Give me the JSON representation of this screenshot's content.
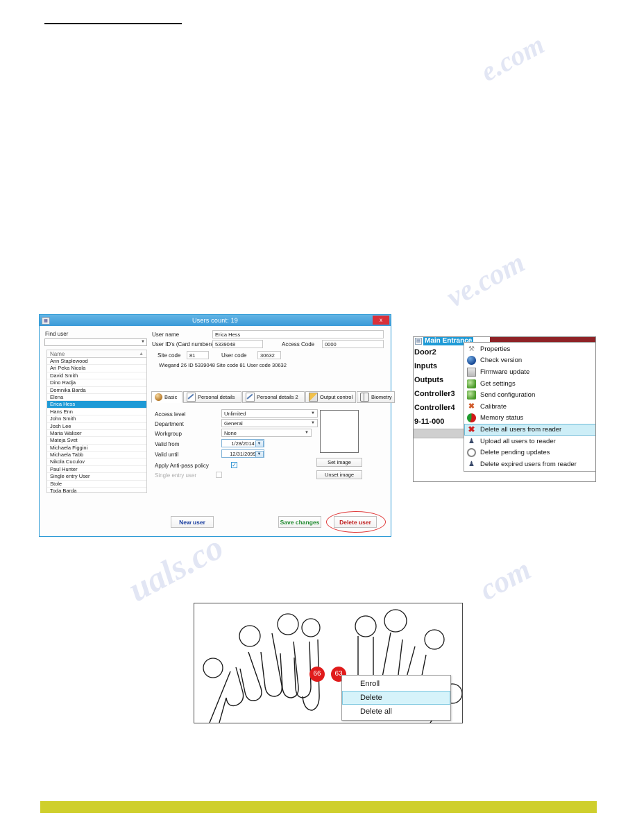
{
  "page": {
    "rule": "",
    "bottom_bar_color": "#cfcf2c",
    "watermarks": [
      "manualshive.com",
      "manualshive.com",
      "manualshive.com",
      "manualshive"
    ]
  },
  "users_dialog": {
    "title": "Users count: 19",
    "close_label": "x",
    "window_icon": "users-icon",
    "find_user_label": "Find user",
    "find_user_value": "",
    "list_header": "Name",
    "users": [
      "Ann Staplewood",
      "Ari Peka Nicola",
      "David Smith",
      "Dino Radja",
      "Domnika Barda",
      "Elena",
      "Erica Hess",
      "Hans Enn",
      "John Smith",
      "Josh Lee",
      "Maria Waliser",
      "Mateja Svet",
      "Michaela Figgini",
      "Michaela Tabb",
      "Nikola Cuculov",
      "Paul Hunter",
      "Single entry User",
      "Stole",
      "Toda Barda"
    ],
    "selected_user": "Erica Hess",
    "fields": {
      "user_name_label": "User name",
      "user_name_value": "Erica Hess",
      "user_ids_label": "User ID's (Card numbers)",
      "user_ids_value": "5339048",
      "access_code_label": "Access Code",
      "access_code_value": "0000",
      "site_code_label": "Site code",
      "site_code_value": "81",
      "user_code_label": "User code",
      "user_code_value": "30632",
      "wiegand_line": "Wiegand 26   ID     5339048              Site code    81           User code      30632"
    },
    "tabs": [
      {
        "label": "Basic",
        "icon": "basic-icon",
        "active": true
      },
      {
        "label": "Personal details",
        "icon": "pencil-icon",
        "active": false
      },
      {
        "label": "Personal details 2",
        "icon": "pencil-icon",
        "active": false
      },
      {
        "label": "Output control",
        "icon": "output-icon",
        "active": false
      },
      {
        "label": "Biometry",
        "icon": "biometry-icon",
        "active": false
      }
    ],
    "basic_form": {
      "access_level_label": "Access level",
      "access_level_value": "Unlimited",
      "department_label": "Department",
      "department_value": "General",
      "workgroup_label": "Workgroup",
      "workgroup_value": "None",
      "valid_from_label": "Valid from",
      "valid_from_value": "1/28/2014",
      "valid_until_label": "Valid until",
      "valid_until_value": "12/31/2099",
      "anti_pass_label": "Apply Anti-pass policy",
      "anti_pass_checked": "✓",
      "single_entry_label": "Single entry user",
      "single_entry_checked": ""
    },
    "image_panel": {
      "set_image_label": "Set image",
      "unset_image_label": "Unset image"
    },
    "buttons": {
      "new_user": "New user",
      "save_changes": "Save changes",
      "delete_user": "Delete user"
    }
  },
  "reader_panel": {
    "selected_tree_node": "Main Entrance",
    "tree_items": [
      "Door2",
      "Inputs",
      "Outputs",
      "Controller3",
      "Controller4",
      "9-11-000"
    ],
    "context_menu": [
      {
        "label": "Properties",
        "icon": "wrench-icon",
        "highlighted": false
      },
      {
        "label": "Check version",
        "icon": "globe-icon",
        "highlighted": false
      },
      {
        "label": "Firmware update",
        "icon": "firmware-icon",
        "highlighted": false
      },
      {
        "label": "Get settings",
        "icon": "get-settings-icon",
        "highlighted": false
      },
      {
        "label": "Send configuration",
        "icon": "send-config-icon",
        "highlighted": false
      },
      {
        "label": "Calibrate",
        "icon": "calibrate-icon",
        "highlighted": false
      },
      {
        "label": "Memory status",
        "icon": "memory-status-icon",
        "highlighted": false
      },
      {
        "label": "Delete all users from reader",
        "icon": "delete-all-users-icon",
        "highlighted": true
      },
      {
        "label": "Upload all users to reader",
        "icon": "upload-users-icon",
        "highlighted": false
      },
      {
        "label": "Delete pending updates",
        "icon": "delete-pending-icon",
        "highlighted": false
      },
      {
        "label": "Delete expired users from reader",
        "icon": "delete-expired-icon",
        "highlighted": false
      }
    ]
  },
  "hand_diagram": {
    "badges": [
      "66",
      "63"
    ],
    "context_menu": [
      {
        "label": "Enroll",
        "highlighted": false
      },
      {
        "label": "Delete",
        "highlighted": true
      },
      {
        "label": "Delete all",
        "highlighted": false
      }
    ]
  }
}
